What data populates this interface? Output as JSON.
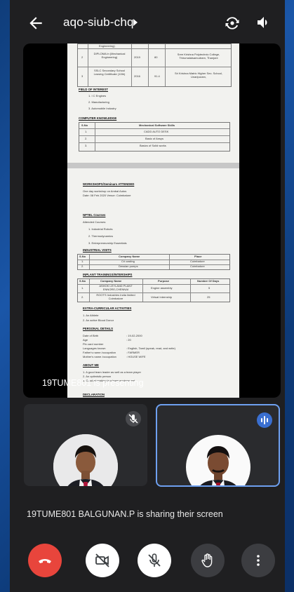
{
  "meeting": {
    "code": "aqo-siub-chq"
  },
  "stage": {
    "presenter_label": "19TUME801 is presenting",
    "document": {
      "edu_rows": [
        {
          "no": "",
          "course": "Engineering)",
          "year": "",
          "pct": "",
          "inst": ""
        },
        {
          "no": "2",
          "course": "DIPLOMA in (Mechanical Engineering)",
          "year": "2019",
          "pct": "80",
          "inst": "Sree Krishna Polytechnic College, Thirumalaisamudram, Thanjore"
        },
        {
          "no": "3",
          "course": "SSLC Secondary School Leaving Certificate (10th)",
          "year": "2016",
          "pct": "91.4",
          "inst": "Sri Krishna Matric Higher Sec. School, Unaripuram,"
        }
      ],
      "field_heading": "FIELD OF INTEREST",
      "field_items": [
        "1.  I C Engines",
        "2.  Manufacturing",
        "3.  Automobile Industry"
      ],
      "computer_heading": "COMPUTER KNOWLEDGE",
      "computer_cols": [
        "S.No",
        "Mechanical Software Skills"
      ],
      "computer_rows": [
        [
          "1.",
          "CADD AUTO DESK"
        ],
        [
          "2.",
          "Basic of Ansys"
        ],
        [
          "3.",
          "Basics of Solid works"
        ]
      ],
      "workshop_heading": "WORKSHOPS/Seminars ATTENDED",
      "workshop_line1": "One day workshop on Ambal Autos",
      "workshop_line2": "Date: 08 Feb 2020 Venue: Coimbatore",
      "nptel_heading": "NPTEL Courses",
      "nptel_intro": "Attended Courses:",
      "nptel_items": [
        "1.  Industrial Robots",
        "2.  Thermodynamics",
        "3.  Entrepreneurship Essentials"
      ],
      "visit_heading": "INDUSTRIAL VISITS",
      "visit_cols": [
        "S.No",
        "Company Name",
        "Place"
      ],
      "visit_rows": [
        [
          "1.",
          "Cri casting",
          "Coimbatore"
        ],
        [
          "2.",
          "Dessian pumps",
          "Coimbatore"
        ]
      ],
      "inplant_heading": "INPLANT TRAININGS/INTERSHIPS",
      "inplant_cols": [
        "S.No",
        "Company Name",
        "Purpose",
        "Number Of Days"
      ],
      "inplant_rows": [
        [
          "1.",
          "ASHOK LEYLAND PLANT ENNORE,CHENNAI",
          "Engine assembly",
          "5"
        ],
        [
          "2.",
          "ROOTS Industries India limited Coimbatore",
          "Virtual Internship",
          "25"
        ]
      ],
      "extra_heading": "EXTRA-CURRICULAR ACTIVITIES",
      "extra_items": [
        "1. An Athlete",
        "2. An active Blood Donor"
      ],
      "personal_heading": "PERSONAL DETAILS",
      "personal_rows": [
        [
          "Date of Birth",
          ": 19-02-2000"
        ],
        [
          "Age",
          ": 20"
        ],
        [
          "Pin card number",
          ""
        ],
        [
          "Languages known",
          ": English, Tamil (speak, read, and write)"
        ],
        [
          "Father's name /occupation",
          ": FARMER"
        ],
        [
          "Mother's name /occupation",
          ": HOUSE WIFE"
        ]
      ],
      "about_heading": "ABOUT ME",
      "about_items": [
        "1. A good team leader as well as a team player",
        "2. An optimistic person",
        "3. Good at working in a team environment"
      ],
      "declaration_heading": "DECLARATION"
    }
  },
  "participants": [
    {
      "name": "participant-1",
      "muted": true
    },
    {
      "name": "participant-2",
      "speaking": true
    }
  ],
  "share_banner": "19TUME801 BALGUNAN.P is sharing their screen",
  "colors": {
    "end_call": "#e8453c",
    "speaking_border": "#6ea0f0",
    "background": "#1f1f21"
  }
}
